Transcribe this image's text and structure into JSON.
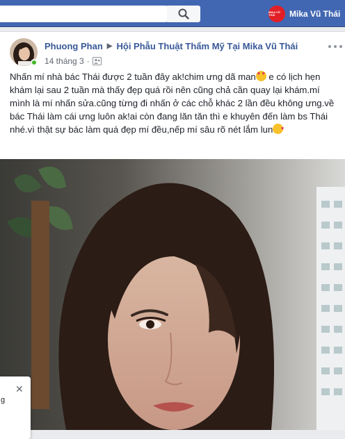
{
  "topbar": {
    "search_placeholder": "",
    "profile_name": "Mika Vũ Thái",
    "profile_avatar_text": "MIKA VŨ THÁI"
  },
  "post": {
    "author": "Phuong Phan",
    "group": "Hội Phẫu Thuật Thẩm Mỹ Tại Mika Vũ Thái",
    "date": "14 tháng 3",
    "privacy_icon": "group-icon",
    "text_part1": "Nhấn mí nhà bác Thái được 2 tuần đây ak!chim ưng dã man",
    "text_part2": " e có lịch hẹn khám lại sau 2 tuần mà thấy đẹp quá rồi nên cũng chả cần quay lại khám.mí mình là mí nhấn sửa.cũng từng đi nhấn ở các chỗ khác 2 lần đều không ưng.về bác Thái làm cái ưng luôn ak!ai còn đang lăn tăn thì e khuyên đến làm bs Thái nhé.vì thật sự bác làm quá đẹp mí đều,nếp mí sâu rõ nét lắm lun"
  },
  "chat_popup": {
    "fragment_1": "",
    "fragment_2": "g"
  },
  "colors": {
    "facebook_blue": "#4267b2",
    "link_blue": "#385898",
    "brand_red": "#e21e26"
  }
}
